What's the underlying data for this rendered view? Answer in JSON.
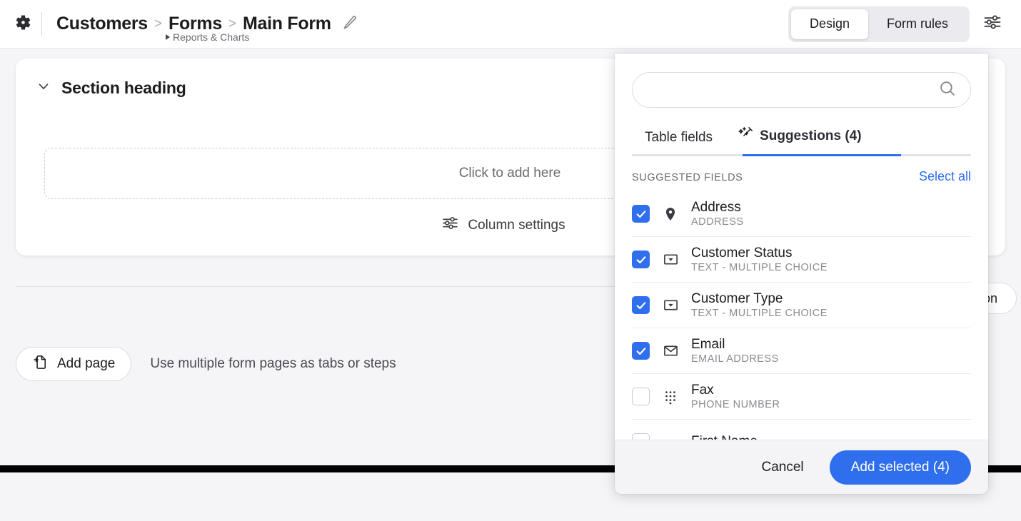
{
  "header": {
    "gear_icon": "gear-icon",
    "breadcrumb": {
      "app": "Customers",
      "sep1": ">",
      "section": "Forms",
      "sep2": ">",
      "page": "Main Form",
      "sub_item": "Reports & Charts",
      "edit_icon": "pencil-icon"
    },
    "view_tabs": [
      {
        "label": "Design",
        "active": true
      },
      {
        "label": "Form rules",
        "active": false
      }
    ],
    "settings_icon": "tune-sliders-icon"
  },
  "canvas": {
    "section": {
      "collapse_icon": "chevron-down-icon",
      "title": "Section heading",
      "drop_zone_label": "Click to add here",
      "column_settings_label": "Column settings",
      "column_settings_icon": "tune-sliders-icon"
    },
    "add_section_label": "Add section",
    "add_page": {
      "label": "Add page",
      "icon": "add-page-icon",
      "hint": "Use multiple form pages as tabs or steps"
    }
  },
  "field_picker": {
    "search": {
      "value": "",
      "placeholder": "",
      "icon": "search-icon"
    },
    "tabs": [
      {
        "label": "Table fields",
        "active": false,
        "icon": null
      },
      {
        "label": "Suggestions (4)",
        "active": true,
        "icon": "magic-wand-icon"
      }
    ],
    "list_header": "SUGGESTED FIELDS",
    "select_all_label": "Select all",
    "fields": [
      {
        "name": "Address",
        "type": "ADDRESS",
        "checked": true,
        "icon": "map-pin-icon"
      },
      {
        "name": "Customer Status",
        "type": "TEXT - MULTIPLE CHOICE",
        "checked": true,
        "icon": "dropdown-icon"
      },
      {
        "name": "Customer Type",
        "type": "TEXT - MULTIPLE CHOICE",
        "checked": true,
        "icon": "dropdown-icon"
      },
      {
        "name": "Email",
        "type": "EMAIL ADDRESS",
        "checked": true,
        "icon": "envelope-icon"
      },
      {
        "name": "Fax",
        "type": "PHONE NUMBER",
        "checked": false,
        "icon": "dialpad-icon"
      },
      {
        "name": "First Name",
        "type": "",
        "checked": false,
        "icon": "text-field-icon"
      }
    ],
    "footer": {
      "cancel_label": "Cancel",
      "add_selected_label": "Add selected (4)"
    }
  },
  "colors": {
    "accent": "#2f6fed",
    "page_bg": "#f5f4f7",
    "text": "#1d1d1f",
    "muted": "#8a8a92"
  }
}
